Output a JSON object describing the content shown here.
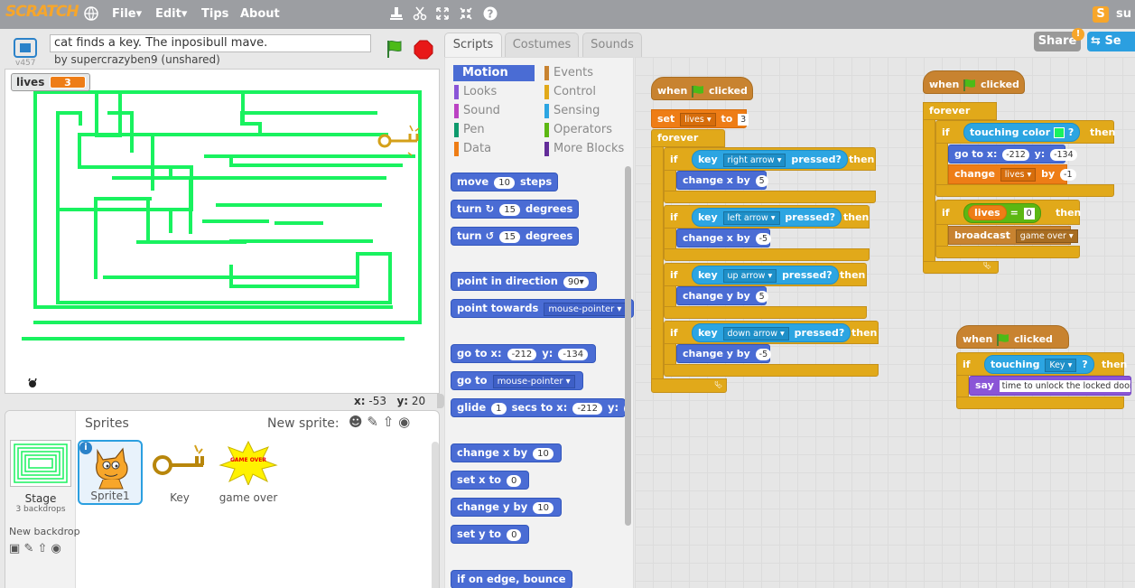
{
  "topbar": {
    "logo": "SCRATCH",
    "menus": {
      "file": "File▾",
      "edit": "Edit▾",
      "tips": "Tips",
      "about": "About"
    },
    "user": "su",
    "share": "Share",
    "see_project": "Se",
    "notif": "!"
  },
  "stage": {
    "version": "v457",
    "project_title": "cat finds a key. The inposibull mave.",
    "byline": "by supercrazyben9 (unshared)",
    "monitor_label": "lives",
    "monitor_value": "3",
    "x_label": "x:",
    "x_value": "-53",
    "y_label": "y:",
    "y_value": "20"
  },
  "sprites": {
    "header": "Sprites",
    "new_sprite": "New sprite:",
    "stage_label": "Stage",
    "backdrops": "3 backdrops",
    "new_backdrop": "New backdrop",
    "items": [
      {
        "name": "Sprite1"
      },
      {
        "name": "Key"
      },
      {
        "name": "game over"
      }
    ],
    "gameover_text": "GAME OVER"
  },
  "tabs": {
    "scripts": "Scripts",
    "costumes": "Costumes",
    "sounds": "Sounds"
  },
  "categories": {
    "motion": "Motion",
    "looks": "Looks",
    "sound": "Sound",
    "pen": "Pen",
    "data": "Data",
    "events": "Events",
    "control": "Control",
    "sensing": "Sensing",
    "operators": "Operators",
    "more": "More Blocks"
  },
  "palette": {
    "move": "move",
    "move_n": "10",
    "steps": "steps",
    "turn": "turn",
    "turn_n": "15",
    "degrees": "degrees",
    "point_dir": "point in direction",
    "point_dir_v": "90",
    "point_towards": "point towards",
    "mouse_pointer": "mouse-pointer",
    "goto_x": "go to x:",
    "goto_xv": "-212",
    "y": "y:",
    "goto_yv": "-134",
    "goto": "go to",
    "glide": "glide",
    "glide_n": "1",
    "secs_to_x": "secs to x:",
    "change_x": "change x by",
    "change_x_n": "10",
    "set_x": "set x to",
    "set_x_n": "0",
    "change_y": "change y by",
    "change_y_n": "10",
    "set_y": "set y to",
    "set_y_n": "0",
    "bounce": "if on edge, bounce"
  },
  "script1": {
    "when": "when",
    "clicked": "clicked",
    "set": "set",
    "var": "lives",
    "to": "to",
    "val": "3",
    "forever": "forever",
    "if": "if",
    "then": "then",
    "key": "key",
    "pressed": "pressed?",
    "right": "right arrow",
    "left": "left arrow",
    "up": "up arrow",
    "down": "down arrow",
    "change_x": "change x by",
    "change_y": "change y by",
    "pos": "5",
    "neg": "-5"
  },
  "script2": {
    "when": "when",
    "clicked": "clicked",
    "forever": "forever",
    "if": "if",
    "then": "then",
    "touching_color": "touching color",
    "q": "?",
    "goto": "go to x:",
    "x": "-212",
    "y_label": "y:",
    "y": "-134",
    "change": "change",
    "var": "lives",
    "by": "by",
    "by_val": "-1",
    "lives": "lives",
    "eq": "=",
    "zero": "0",
    "broadcast": "broadcast",
    "msg": "game over"
  },
  "script3": {
    "when": "when",
    "clicked": "clicked",
    "if": "if",
    "then": "then",
    "touching": "touching",
    "sprite": "Key",
    "q": "?",
    "say": "say",
    "say_text": "time to unlock the locked door"
  },
  "colors": {
    "wall": "#19f25f",
    "accent": "#f7a62a",
    "motion": "#4a6cd4"
  }
}
